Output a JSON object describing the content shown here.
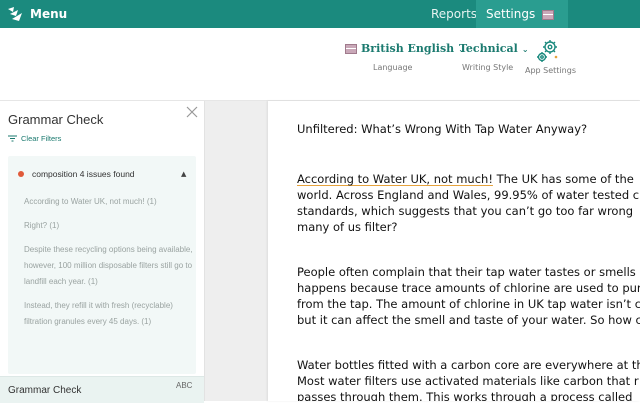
{
  "topbar": {
    "menu_label": "Menu",
    "tabs": [
      {
        "label": "Reports"
      },
      {
        "label": "Settings"
      }
    ]
  },
  "settings": {
    "language": {
      "value": "British English",
      "caption": "Language"
    },
    "writing_style": {
      "value": "Technical",
      "caption": "Writing Style"
    },
    "app_settings": {
      "caption": "App Settings"
    }
  },
  "panel": {
    "title": "Grammar Check",
    "clear_filters": "Clear Filters",
    "group_label": "composition 4 issues found",
    "issues": [
      "According to Water UK, not much! (1)",
      "Right? (1)",
      "Despite these recycling options being available, however, 100 million disposable filters still go to landfill each year. (1)",
      "Instead, they refill it with fresh (recyclable) filtration granules every 45 days. (1)"
    ],
    "bottom_card_title": "Grammar Check",
    "bottom_card_badge": "ABC"
  },
  "document": {
    "title": "Unfiltered: What’s Wrong With Tap Water Anyway?",
    "para1": {
      "highlight": "According to Water UK, not much!",
      "line1_rest": " The UK has some of the",
      "line2": "world. Across England and Wales, 99.95% of water tested c",
      "line3": "standards, which suggests that you can’t go too far wrong",
      "line4": "many of us filter?"
    },
    "para2": {
      "line1": "People often complain that their tap water tastes or smells",
      "line2": "happens because trace amounts of chlorine are used to pur",
      "line3": "from the tap. The amount of chlorine in UK tap water isn’t c",
      "line4": "but it can affect the smell and taste of your water. So how c"
    },
    "para3": {
      "line1": "Water bottles fitted with a carbon core are everywhere at th",
      "line2": "Most water filters use activated materials like carbon that r",
      "line3": "passes through them. This works through a process called"
    }
  },
  "colors": {
    "brand_teal": "#1b8a7e",
    "accent_text": "#1b7a6f",
    "issue_dot": "#e05a3a",
    "highlight_underline": "#e6a23c"
  }
}
